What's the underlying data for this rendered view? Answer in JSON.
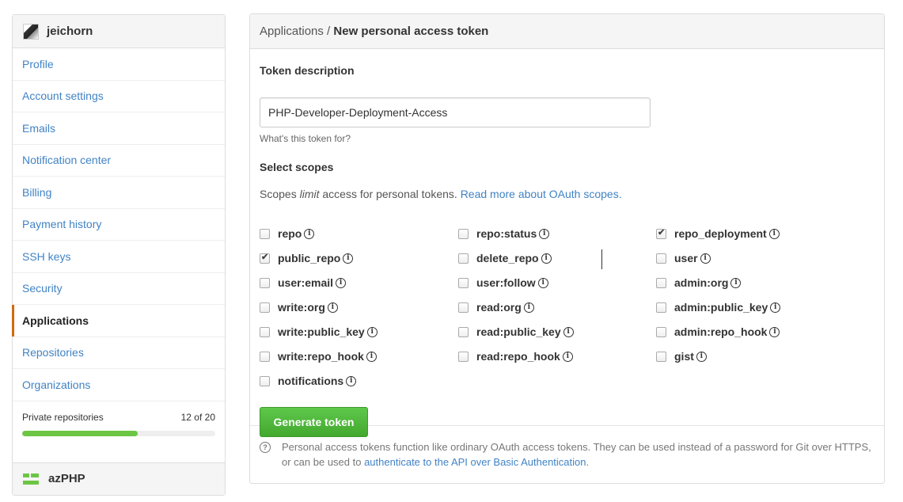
{
  "sidebar": {
    "username": "jeichorn",
    "items": [
      {
        "label": "Profile",
        "selected": false
      },
      {
        "label": "Account settings",
        "selected": false
      },
      {
        "label": "Emails",
        "selected": false
      },
      {
        "label": "Notification center",
        "selected": false
      },
      {
        "label": "Billing",
        "selected": false
      },
      {
        "label": "Payment history",
        "selected": false
      },
      {
        "label": "SSH keys",
        "selected": false
      },
      {
        "label": "Security",
        "selected": false
      },
      {
        "label": "Applications",
        "selected": true
      },
      {
        "label": "Repositories",
        "selected": false
      },
      {
        "label": "Organizations",
        "selected": false
      }
    ],
    "private_repos": {
      "label": "Private repositories",
      "count": "12 of 20",
      "used": 12,
      "total": 20
    },
    "org_name": "azPHP"
  },
  "breadcrumb": {
    "parent": "Applications",
    "separator": " / ",
    "current": "New personal access token"
  },
  "form": {
    "description_label": "Token description",
    "description_value": "PHP-Developer-Deployment-Access",
    "description_hint": "What's this token for?",
    "scopes_label": "Select scopes",
    "scopes_note_pre": "Scopes ",
    "scopes_note_em": "limit",
    "scopes_note_post": " access for personal tokens. ",
    "scopes_note_link": "Read more about OAuth scopes.",
    "scopes": [
      {
        "name": "repo",
        "checked": false
      },
      {
        "name": "repo:status",
        "checked": false
      },
      {
        "name": "repo_deployment",
        "checked": true
      },
      {
        "name": "public_repo",
        "checked": true
      },
      {
        "name": "delete_repo",
        "checked": false
      },
      {
        "name": "user",
        "checked": false
      },
      {
        "name": "user:email",
        "checked": false
      },
      {
        "name": "user:follow",
        "checked": false
      },
      {
        "name": "admin:org",
        "checked": false
      },
      {
        "name": "write:org",
        "checked": false
      },
      {
        "name": "read:org",
        "checked": false
      },
      {
        "name": "admin:public_key",
        "checked": false
      },
      {
        "name": "write:public_key",
        "checked": false
      },
      {
        "name": "read:public_key",
        "checked": false
      },
      {
        "name": "admin:repo_hook",
        "checked": false
      },
      {
        "name": "write:repo_hook",
        "checked": false
      },
      {
        "name": "read:repo_hook",
        "checked": false
      },
      {
        "name": "gist",
        "checked": false
      },
      {
        "name": "notifications",
        "checked": false
      }
    ],
    "submit_label": "Generate token"
  },
  "footer": {
    "text_pre": "Personal access tokens function like ordinary OAuth access tokens. They can be used instead of a password for Git over HTTPS, or can be used to ",
    "link": "authenticate to the API over Basic Authentication",
    "text_post": "."
  },
  "colors": {
    "link": "#4183c4",
    "accent": "#d26911",
    "button": "#4cae3a",
    "progress": "#6cc644"
  }
}
